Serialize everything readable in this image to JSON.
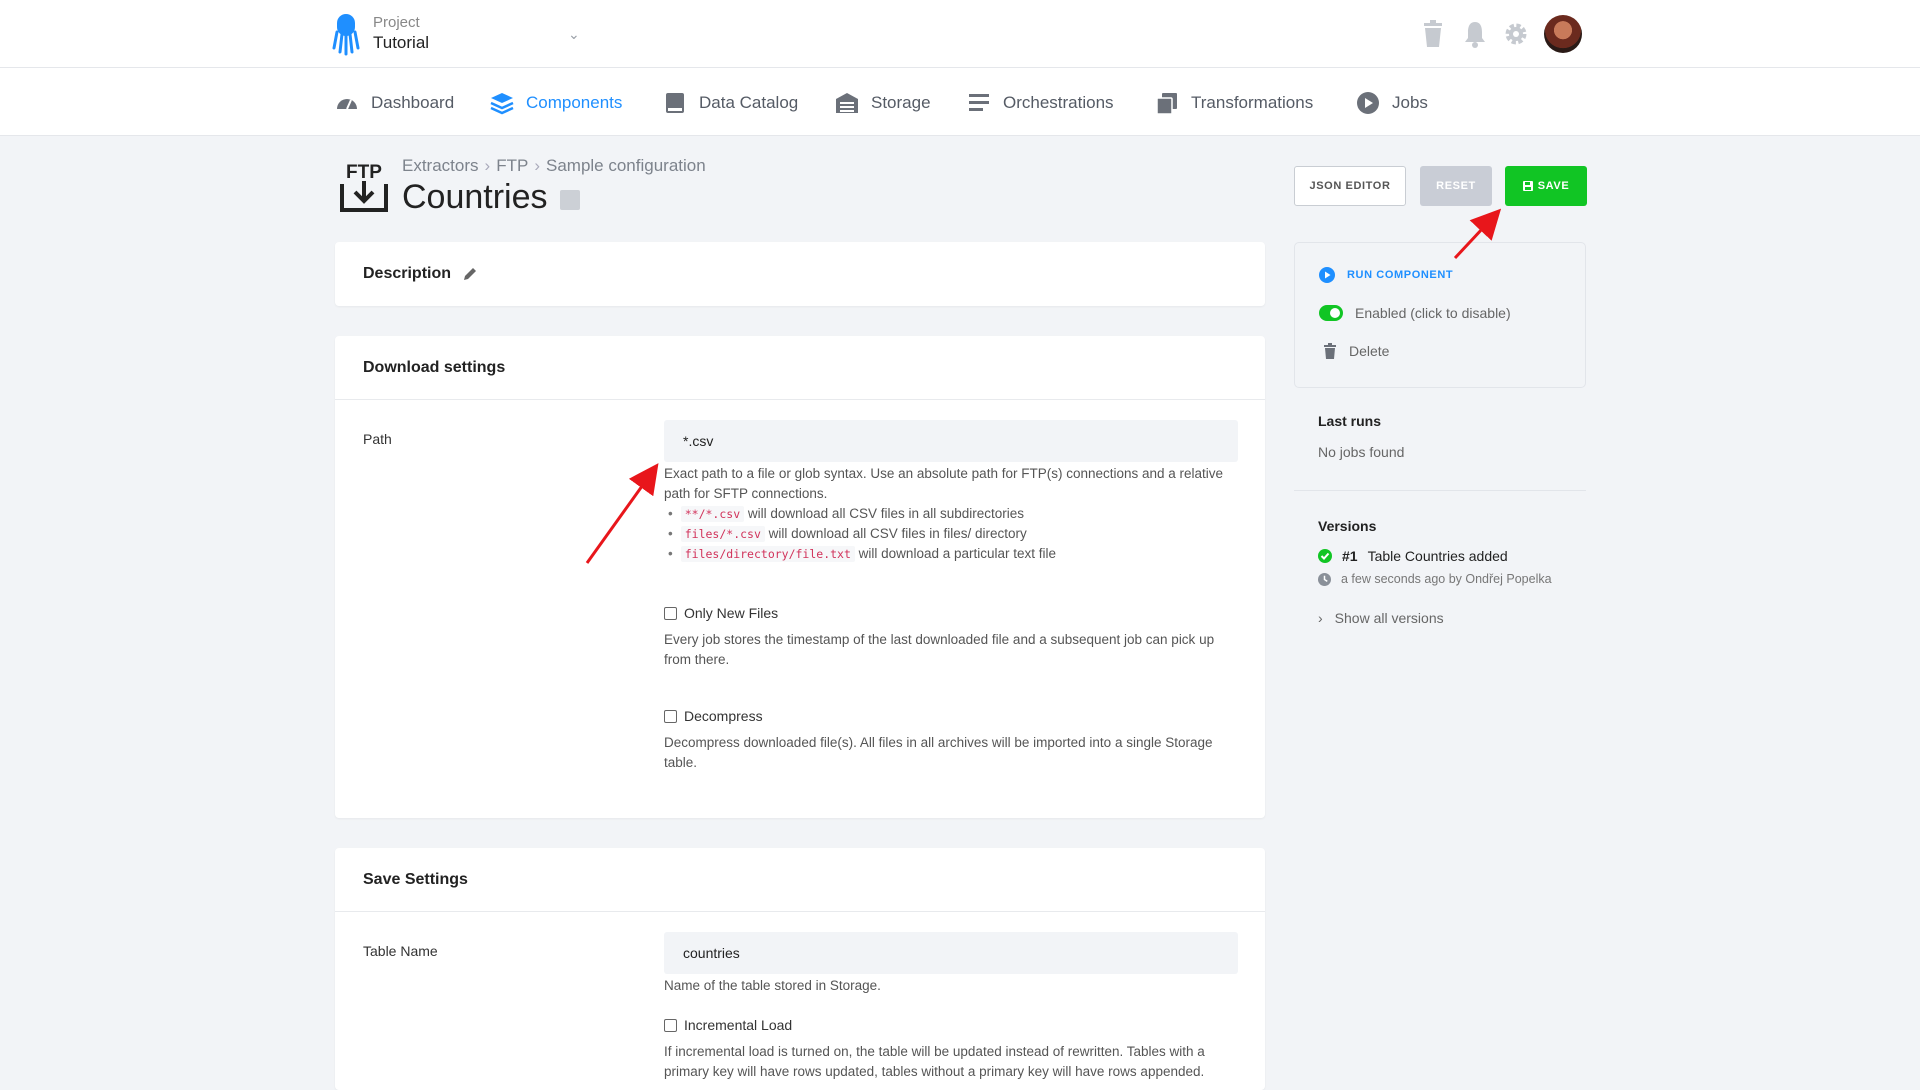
{
  "project": {
    "label": "Project",
    "name": "Tutorial"
  },
  "nav": [
    {
      "label": "Dashboard",
      "icon": "dashboard-icon",
      "active": false
    },
    {
      "label": "Components",
      "icon": "layers-icon",
      "active": true
    },
    {
      "label": "Data Catalog",
      "icon": "book-icon",
      "active": false
    },
    {
      "label": "Storage",
      "icon": "warehouse-icon",
      "active": false
    },
    {
      "label": "Orchestrations",
      "icon": "bars-icon",
      "active": false
    },
    {
      "label": "Transformations",
      "icon": "copy-icon",
      "active": false
    },
    {
      "label": "Jobs",
      "icon": "play-circle-icon",
      "active": false
    }
  ],
  "breadcrumb": [
    "Extractors",
    "FTP",
    "Sample configuration"
  ],
  "title": "Countries",
  "icon_text": "FTP",
  "buttons": {
    "json_editor": "JSON EDITOR",
    "reset": "RESET",
    "save": "SAVE"
  },
  "description": {
    "heading": "Description"
  },
  "download_settings": {
    "heading": "Download settings",
    "path_label": "Path",
    "path_value": "*.csv",
    "path_help": "Exact path to a file or glob syntax. Use an absolute path for FTP(s) connections and a relative path for SFTP connections.",
    "examples": [
      {
        "code": "**/*.csv",
        "text": "will download all CSV files in all subdirectories"
      },
      {
        "code": "files/*.csv",
        "text": "will download all CSV files in files/ directory"
      },
      {
        "code": "files/directory/file.txt",
        "text": "will download a particular text file"
      }
    ],
    "only_new_files": {
      "label": "Only New Files",
      "checked": false,
      "help": "Every job stores the timestamp of the last downloaded file and a subsequent job can pick up from there."
    },
    "decompress": {
      "label": "Decompress",
      "checked": false,
      "help": "Decompress downloaded file(s). All files in all archives will be imported into a single Storage table."
    }
  },
  "save_settings": {
    "heading": "Save Settings",
    "table_name_label": "Table Name",
    "table_name_value": "countries",
    "table_name_help": "Name of the table stored in Storage.",
    "incremental": {
      "label": "Incremental Load",
      "checked": false,
      "help": "If incremental load is turned on, the table will be updated instead of rewritten. Tables with a primary key will have rows updated, tables without a primary key will have rows appended."
    }
  },
  "sidebar": {
    "run": "RUN COMPONENT",
    "enabled": "Enabled (click to disable)",
    "delete": "Delete",
    "last_runs_heading": "Last runs",
    "last_runs_text": "No jobs found",
    "versions_heading": "Versions",
    "version_number": "#1",
    "version_text": "Table Countries added",
    "version_meta": "a few seconds ago by Ondřej Popelka",
    "show_all": "Show all versions"
  },
  "colors": {
    "accent": "#1f8fff",
    "save": "#11c524",
    "annotation_arrow": "#e8161b"
  }
}
